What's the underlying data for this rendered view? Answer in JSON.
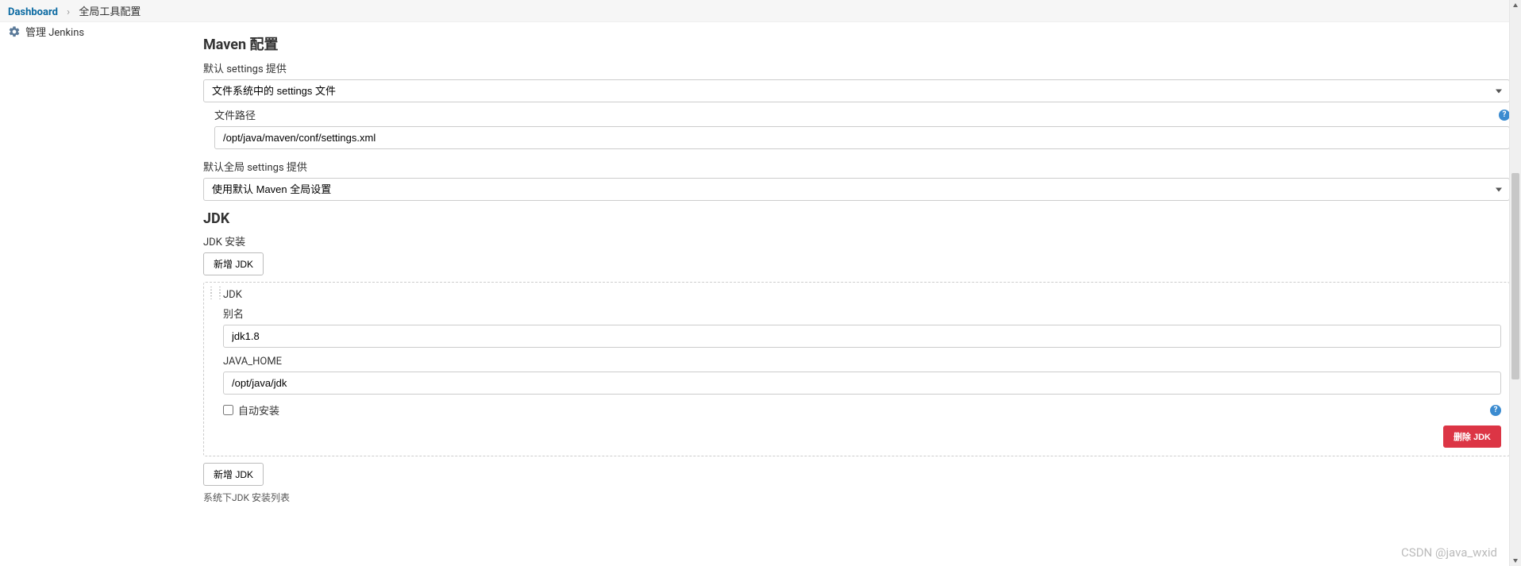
{
  "breadcrumb": {
    "dashboard": "Dashboard",
    "current": "全局工具配置"
  },
  "sidebar": {
    "manage_jenkins": "管理 Jenkins"
  },
  "maven_section": {
    "title": "Maven 配置",
    "default_settings_label": "默认 settings 提供",
    "default_settings_value": "文件系统中的 settings 文件",
    "file_path_label": "文件路径",
    "file_path_value": "/opt/java/maven/conf/settings.xml",
    "global_settings_label": "默认全局 settings 提供",
    "global_settings_value": "使用默认 Maven 全局设置"
  },
  "jdk_section": {
    "title": "JDK",
    "install_label": "JDK 安装",
    "add_btn": "新增 JDK",
    "block_title": "JDK",
    "name_label": "别名",
    "name_value": "jdk1.8",
    "java_home_label": "JAVA_HOME",
    "java_home_value": "/opt/java/jdk",
    "auto_install_label": "自动安装",
    "delete_btn": "删除 JDK",
    "add_btn2": "新增 JDK",
    "list_caption": "系统下JDK 安装列表"
  },
  "watermark": "CSDN @java_wxid"
}
